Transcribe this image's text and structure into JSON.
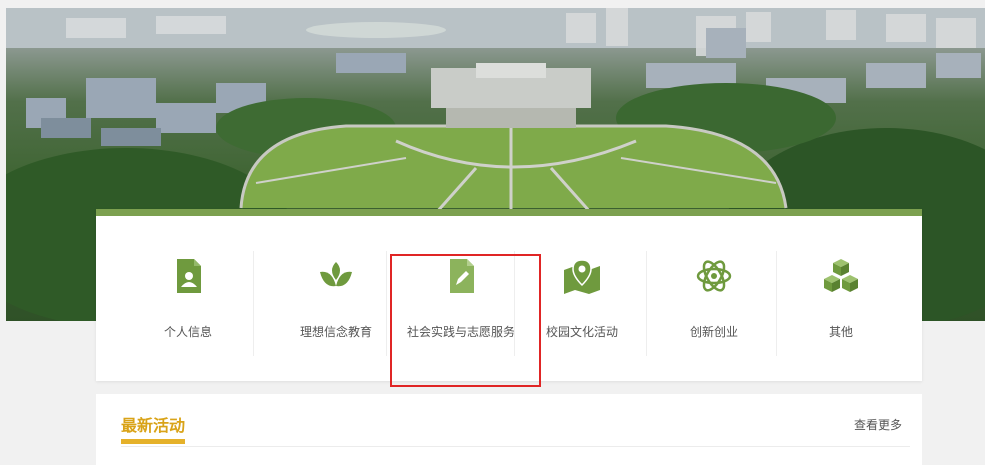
{
  "categories": [
    {
      "label": "个人信息",
      "icon": "id-card-icon"
    },
    {
      "label": "理想信念教育",
      "icon": "sprout-icon"
    },
    {
      "label": "社会实践与志愿服务",
      "icon": "document-pen-icon"
    },
    {
      "label": "校园文化活动",
      "icon": "map-pin-icon"
    },
    {
      "label": "创新创业",
      "icon": "atom-icon"
    },
    {
      "label": "其他",
      "icon": "cubes-icon"
    }
  ],
  "latest": {
    "title": "最新活动",
    "more": "查看更多"
  },
  "colors": {
    "accent_green": "#7ca04f",
    "icon_green": "#6f9a3e",
    "title_gold": "#d9a318",
    "highlight_red": "#e02525"
  }
}
